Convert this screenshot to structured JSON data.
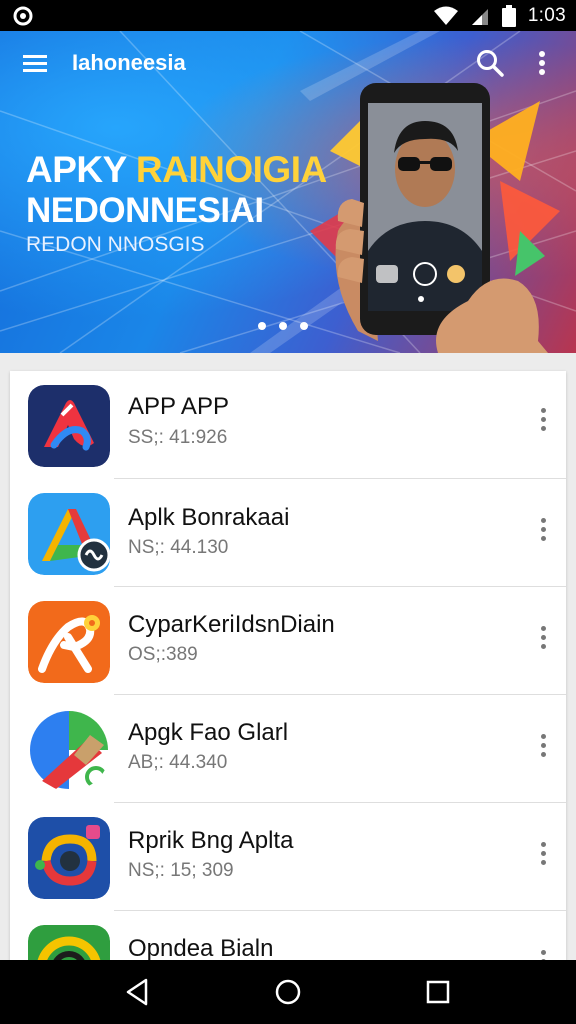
{
  "status_bar": {
    "time": "1:03"
  },
  "app_bar": {
    "title": "Iahoneesia"
  },
  "banner": {
    "line1_part1": "APKY ",
    "line1_accent": "RAINOIGIA",
    "line2": "NEDONNESIAI",
    "subtitle": "REDON NNOSGIS",
    "carousel_pages": 3
  },
  "apps": [
    {
      "name": "APP APP",
      "meta": "SS;: 41:926",
      "icon": "red-blue-a-logo-icon"
    },
    {
      "name": "Aplk Bonrakaai",
      "meta": "NS;: 44.130",
      "icon": "rainbow-a-logo-icon"
    },
    {
      "name": "CyparKeriIdsnDiain",
      "meta": "OS;:389",
      "icon": "orange-p-logo-icon"
    },
    {
      "name": "Apgk Fao Glarl",
      "meta": "AB;: 44.340",
      "icon": "green-red-pencil-logo-icon"
    },
    {
      "name": "Rprik Bng Aplta",
      "meta": "NS;: 15; 309",
      "icon": "blue-ring-logo-icon"
    },
    {
      "name": "Opndea Bialn",
      "meta": "",
      "icon": "green-yellow-ring-logo-icon"
    }
  ],
  "colors": {
    "banner_blue": "#1a86e8",
    "accent_yellow": "#ffd23a",
    "status_bar": "#000000"
  }
}
